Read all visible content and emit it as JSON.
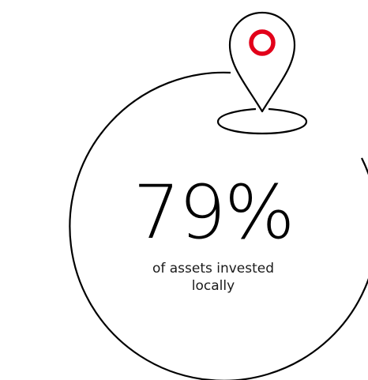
{
  "stat": {
    "value": "79%",
    "caption": "of assets invested locally"
  },
  "colors": {
    "stroke": "#000000",
    "accent": "#e2001a",
    "background": "#ffffff"
  },
  "icons": {
    "pin": "location-pin-icon"
  }
}
